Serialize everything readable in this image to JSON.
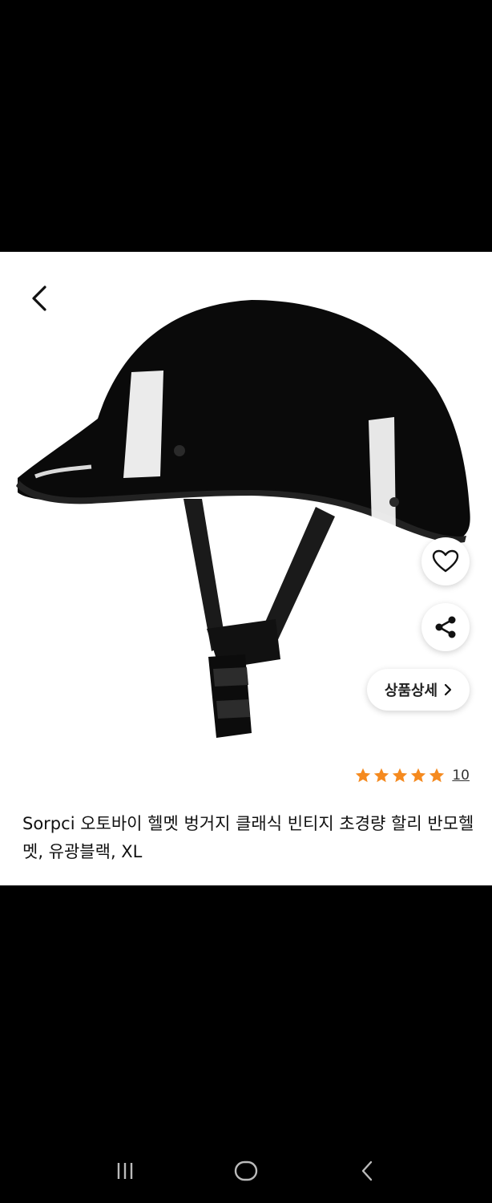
{
  "product": {
    "title": "Sorpci 오토바이 헬멧 벙거지 클래식 빈티지 초경량 할리 반모헬멧, 유광블랙, XL",
    "rating": 5,
    "review_count": "10",
    "detail_label": "상품상세"
  },
  "colors": {
    "star": "#F58A1F",
    "text": "#111111",
    "background": "#FFFFFF"
  },
  "icons": {
    "back": "chevron-left-icon",
    "like": "heart-icon",
    "share": "share-icon",
    "detail": "chevron-right-icon",
    "nav_recents": "recents-icon",
    "nav_home": "home-icon",
    "nav_back": "back-icon"
  }
}
